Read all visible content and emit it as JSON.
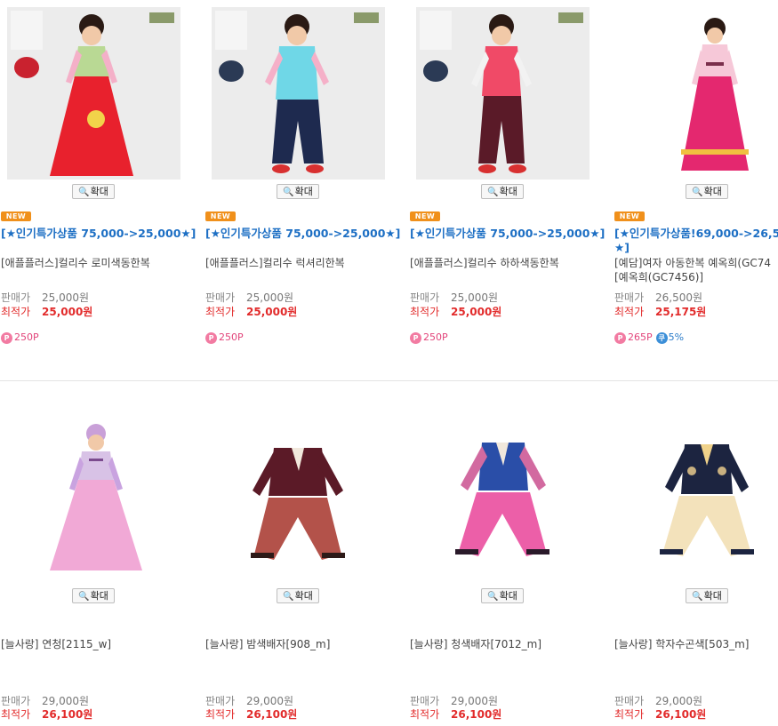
{
  "zoom_label": "확대",
  "labels": {
    "sale": "판매가",
    "best": "최적가"
  },
  "colors": {
    "promo": "#1d6fc4",
    "best_price": "#e22b2b",
    "new_badge": "#f0901b",
    "point": "#e2447a",
    "coupon": "#2b7cc9"
  },
  "products": [
    {
      "badge": "NEW",
      "promo": "[★인기특가상품 75,000->25,000★]",
      "name": "[애플플러스]컬리수 로미색동한복",
      "name2": "",
      "sale_price": "25,000원",
      "best_price": "25,000원",
      "points": "250P",
      "coupon": ""
    },
    {
      "badge": "NEW",
      "promo": "[★인기특가상품 75,000->25,000★]",
      "name": "[애플플러스]컬리수 럭셔리한복",
      "name2": "",
      "sale_price": "25,000원",
      "best_price": "25,000원",
      "points": "250P",
      "coupon": ""
    },
    {
      "badge": "NEW",
      "promo": "[★인기특가상품 75,000->25,000★]",
      "name": "[애플플러스]컬리수 하하색동한복",
      "name2": "",
      "sale_price": "25,000원",
      "best_price": "25,000원",
      "points": "250P",
      "coupon": ""
    },
    {
      "badge": "NEW",
      "promo": "[★인기특가상품!69,000->26,5",
      "promo2": "★]",
      "name": "[예담]여자 아동한복 예옥희(GC74",
      "name2": "[예옥희(GC7456)]",
      "sale_price": "26,500원",
      "best_price": "25,175원",
      "points": "265P",
      "coupon": "5%"
    },
    {
      "name": "[늘사랑] 연청[2115_w]",
      "sale_price": "29,000원",
      "best_price": "26,100원"
    },
    {
      "name": "[늘사랑] 밤색배자[908_m]",
      "sale_price": "29,000원",
      "best_price": "26,100원"
    },
    {
      "name": "[늘사랑] 청색배자[7012_m]",
      "sale_price": "29,000원",
      "best_price": "26,100원"
    },
    {
      "name": "[늘사랑] 학자수곤색[503_m]",
      "sale_price": "29,000원",
      "best_price": "26,100원"
    }
  ]
}
